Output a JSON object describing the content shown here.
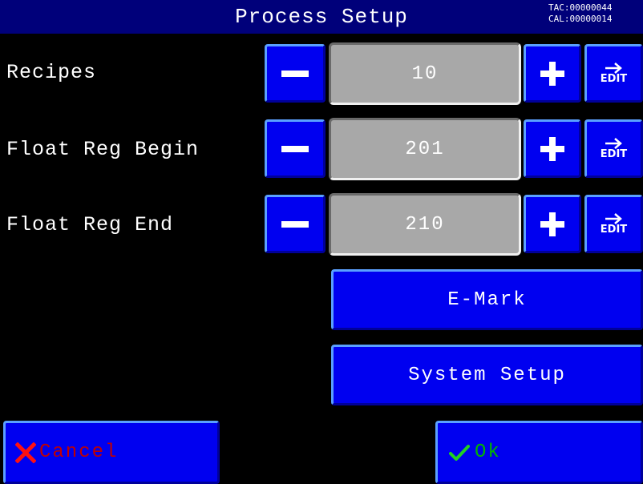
{
  "header": {
    "title": "Process Setup",
    "tac_label": "TAC:00000044",
    "cal_label": "CAL:00000014"
  },
  "rows": [
    {
      "label": "Recipes",
      "value": "10",
      "edit_label": "EDIT"
    },
    {
      "label": "Float Reg Begin",
      "value": "201",
      "edit_label": "EDIT"
    },
    {
      "label": "Float Reg End",
      "value": "210",
      "edit_label": "EDIT"
    }
  ],
  "buttons": {
    "emark_label": "E-Mark",
    "system_setup_label": "System Setup",
    "cancel_label": "Cancel",
    "ok_label": "Ok"
  },
  "icons": {
    "decrement": "minus-icon",
    "increment": "plus-icon",
    "edit": "arrow-right-icon",
    "cancel": "x-icon",
    "ok": "checkmark-icon"
  },
  "colors": {
    "title_bar": "#00007a",
    "button_face": "#0000f0",
    "value_box": "#a8a8a8",
    "cancel_text": "#c00000",
    "ok_text": "#00b400"
  }
}
